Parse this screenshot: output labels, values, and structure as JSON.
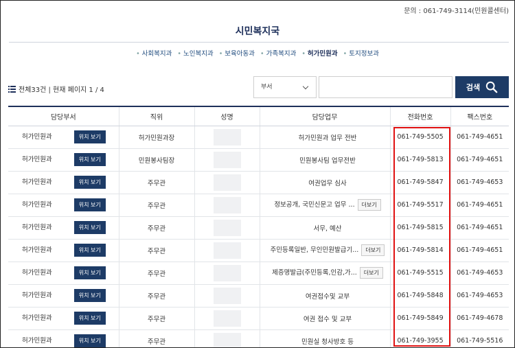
{
  "header": {
    "inquiry": "문의 : 061-749-3114(민원콜센터)",
    "title": "시민복지국"
  },
  "subnav": {
    "items": [
      "사회복지과",
      "노인복지과",
      "보육아동과",
      "가족복지과",
      "허가민원과",
      "토지정보과"
    ],
    "active": "허가민원과"
  },
  "summary": {
    "text": "전체33건 | 현재 페이지 1 / 4"
  },
  "search": {
    "dept_select_value": "부서",
    "input_value": "",
    "button_label": "검색"
  },
  "table": {
    "headers": [
      "담당부서",
      "직위",
      "성명",
      "담당업무",
      "전화번호",
      "팩스번호"
    ],
    "location_button_label": "위치 보기",
    "more_button_label": "더보기",
    "rows": [
      {
        "dept": "허가민원과",
        "position": "허가민원과장",
        "duty": "허가민원과 업무 전반",
        "phone": "061-749-5505",
        "fax": "061-749-4651",
        "more": false
      },
      {
        "dept": "허가민원과",
        "position": "민원봉사팀장",
        "duty": "민원봉사팀 업무전반",
        "phone": "061-749-5813",
        "fax": "061-749-4651",
        "more": false
      },
      {
        "dept": "허가민원과",
        "position": "주무관",
        "duty": "여권업무 심사",
        "phone": "061-749-5847",
        "fax": "061-749-4653",
        "more": false
      },
      {
        "dept": "허가민원과",
        "position": "주무관",
        "duty": "정보공개, 국민신문고 업무 ...",
        "phone": "061-749-5517",
        "fax": "061-749-4651",
        "more": true
      },
      {
        "dept": "허가민원과",
        "position": "주무관",
        "duty": "서무, 예산",
        "phone": "061-749-5815",
        "fax": "061-749-4651",
        "more": false
      },
      {
        "dept": "허가민원과",
        "position": "주무관",
        "duty": "주민등록일반, 무인민원발급기...",
        "phone": "061-749-5814",
        "fax": "061-749-4651",
        "more": true
      },
      {
        "dept": "허가민원과",
        "position": "주무관",
        "duty": "제증명발급(주민등록,인감,가...",
        "phone": "061-749-5515",
        "fax": "061-749-4653",
        "more": true
      },
      {
        "dept": "허가민원과",
        "position": "주무관",
        "duty": "여권접수및 교부",
        "phone": "061-749-5848",
        "fax": "061-749-4653",
        "more": false
      },
      {
        "dept": "허가민원과",
        "position": "주무관",
        "duty": "여권 접수 및 교부",
        "phone": "061-749-5849",
        "fax": "061-749-4678",
        "more": false
      },
      {
        "dept": "허가민원과",
        "position": "주무관",
        "duty": "민원실 청사방호 등",
        "phone": "061-749-3955",
        "fax": "061-749-5516",
        "more": false
      }
    ]
  },
  "colors": {
    "navy": "#1d3b66",
    "highlight": "#e01010"
  }
}
